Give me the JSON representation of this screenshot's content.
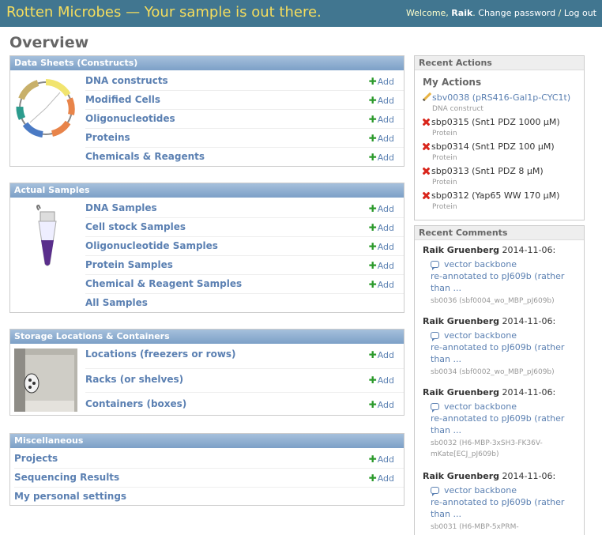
{
  "header": {
    "site_title": "Rotten Microbes — Your sample is out there.",
    "welcome": "Welcome, ",
    "user": "Raik",
    "change_password": "Change password",
    "sep": " / ",
    "logout": "Log out"
  },
  "page_title": "Overview",
  "data_sheets": {
    "caption": "Data Sheets (Constructs)",
    "items": [
      {
        "label": "DNA constructs",
        "add": "Add"
      },
      {
        "label": "Modified Cells",
        "add": "Add"
      },
      {
        "label": "Oligonucleotides",
        "add": "Add"
      },
      {
        "label": "Proteins",
        "add": "Add"
      },
      {
        "label": "Chemicals & Reagents",
        "add": "Add"
      }
    ]
  },
  "actual_samples": {
    "caption": "Actual Samples",
    "items": [
      {
        "label": "DNA Samples",
        "add": "Add"
      },
      {
        "label": "Cell stock Samples",
        "add": "Add"
      },
      {
        "label": "Oligonucleotide Samples",
        "add": "Add"
      },
      {
        "label": "Protein Samples",
        "add": "Add"
      },
      {
        "label": "Chemical & Reagent Samples",
        "add": "Add"
      },
      {
        "label": "All Samples"
      }
    ]
  },
  "storage": {
    "caption": "Storage Locations & Containers",
    "items": [
      {
        "label": "Locations (freezers or rows)",
        "add": "Add"
      },
      {
        "label": "Racks (or shelves)",
        "add": "Add"
      },
      {
        "label": "Containers (boxes)",
        "add": "Add"
      }
    ]
  },
  "misc": {
    "caption": "Miscellaneous",
    "items": [
      {
        "label": "Projects",
        "add": "Add"
      },
      {
        "label": "Sequencing Results",
        "add": "Add"
      },
      {
        "label": "My personal settings"
      }
    ]
  },
  "recent_actions": {
    "caption": "Recent Actions",
    "subheading": "My Actions",
    "items": [
      {
        "icon": "pencil-icon",
        "text": "sbv0038 (pRS416-Gal1p-CYC1t)",
        "type": "DNA construct"
      },
      {
        "icon": "delete-icon",
        "text": "sbp0315 (Snt1 PDZ 1000 µM)",
        "type": "Protein"
      },
      {
        "icon": "delete-icon",
        "text": "sbp0314 (Snt1 PDZ 100 µM)",
        "type": "Protein"
      },
      {
        "icon": "delete-icon",
        "text": "sbp0313 (Snt1 PDZ 8 µM)",
        "type": "Protein"
      },
      {
        "icon": "delete-icon",
        "text": "sbp0312 (Yap65 WW 170 µM)",
        "type": "Protein"
      }
    ]
  },
  "recent_comments": {
    "caption": "Recent Comments",
    "items": [
      {
        "author": "Raik Gruenberg",
        "date": "2014-11-06:",
        "line1": "vector backbone",
        "line2": "re-annotated to pJ609b (rather",
        "line3": "than ...",
        "meta1": "sb0036 (sbf0004_wo_MBP_pJ609b)",
        "meta2": ""
      },
      {
        "author": "Raik Gruenberg",
        "date": "2014-11-06:",
        "line1": "vector backbone",
        "line2": "re-annotated to pJ609b (rather",
        "line3": "than ...",
        "meta1": "sb0034 (sbf0002_wo_MBP_pJ609b)",
        "meta2": ""
      },
      {
        "author": "Raik Gruenberg",
        "date": "2014-11-06:",
        "line1": "vector backbone",
        "line2": "re-annotated to pJ609b (rather",
        "line3": "than ...",
        "meta1": "sb0032 (H6-MBP-3xSH3-FK36V-",
        "meta2": "mKate[ECJ_pJ609b)"
      },
      {
        "author": "Raik Gruenberg",
        "date": "2014-11-06:",
        "line1": "vector backbone",
        "line2": "re-annotated to pJ609b (rather",
        "line3": "than ...",
        "meta1": "sb0031 (H6-MBP-5xPRM-",
        "meta2": ""
      }
    ]
  }
}
